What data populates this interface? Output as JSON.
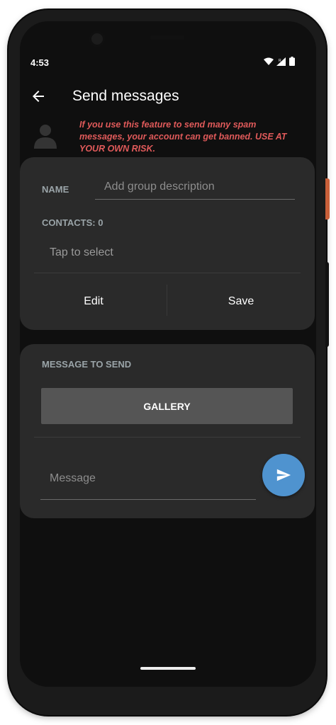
{
  "status_bar": {
    "time": "4:53",
    "icons": [
      "wifi-icon",
      "signal-icon",
      "battery-icon"
    ]
  },
  "app_bar": {
    "title": "Send messages",
    "back_icon": "arrow-back-icon"
  },
  "warning": {
    "text": "If you use this feature to send many spam messages, your account can get banned. USE AT YOUR OWN RISK.",
    "color": "#e05a5a"
  },
  "group_card": {
    "name_label": "NAME",
    "name_placeholder": "Add group description",
    "name_value": "",
    "contacts_label": "CONTACTS: 0",
    "tap_to_select": "Tap to select",
    "edit_label": "Edit",
    "save_label": "Save"
  },
  "message_card": {
    "section_label": "MESSAGE TO SEND",
    "gallery_label": "GALLERY",
    "message_placeholder": "Message",
    "message_value": "",
    "send_icon": "send-icon",
    "send_color": "#4f93cf"
  }
}
